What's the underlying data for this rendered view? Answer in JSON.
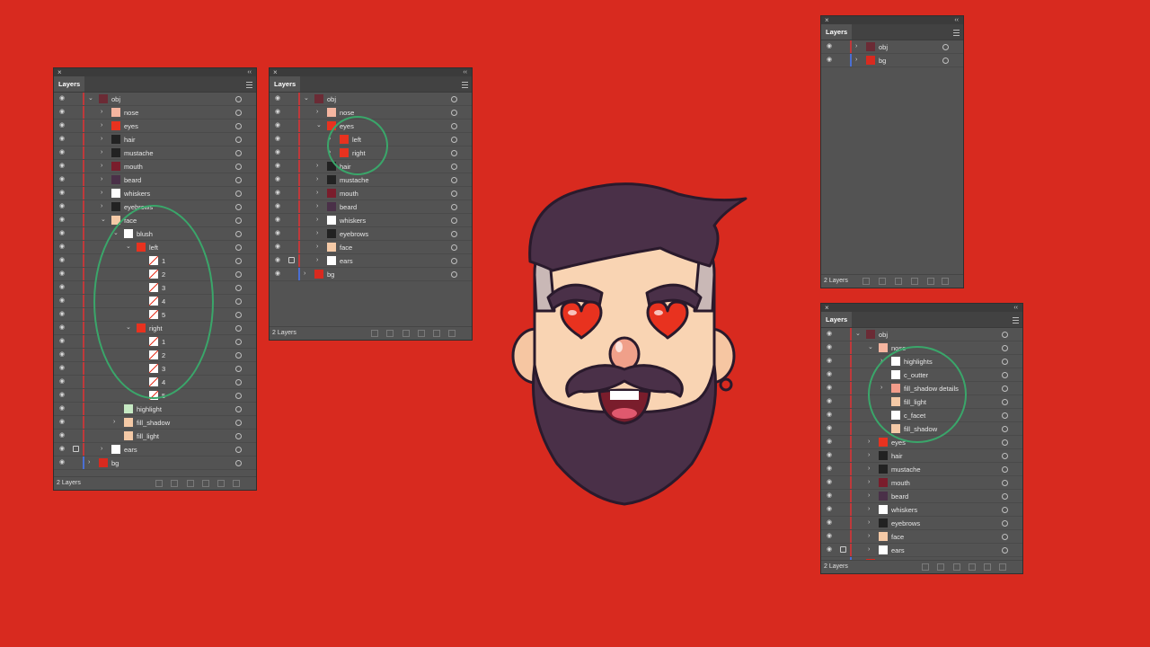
{
  "colors": {
    "background": "#d82a1f",
    "panel": "#535353",
    "circle": "#3aa66a",
    "obj_bar": "#c0393b",
    "bg_bar": "#4a6fd4"
  },
  "common": {
    "tab": "Layers",
    "footer": "2 Layers"
  },
  "panel1": {
    "rows": [
      {
        "label": "obj",
        "level": 0,
        "arrow": "down",
        "bar": "red"
      },
      {
        "label": "nose",
        "level": 1,
        "arrow": "right",
        "bar": "red"
      },
      {
        "label": "eyes",
        "level": 1,
        "arrow": "right",
        "bar": "red"
      },
      {
        "label": "hair",
        "level": 1,
        "arrow": "right",
        "bar": "red"
      },
      {
        "label": "mustache",
        "level": 1,
        "arrow": "right",
        "bar": "red"
      },
      {
        "label": "mouth",
        "level": 1,
        "arrow": "right",
        "bar": "red"
      },
      {
        "label": "beard",
        "level": 1,
        "arrow": "right",
        "bar": "red"
      },
      {
        "label": "whiskers",
        "level": 1,
        "arrow": "right",
        "bar": "red"
      },
      {
        "label": "eyebrows",
        "level": 1,
        "arrow": "right",
        "bar": "red"
      },
      {
        "label": "face",
        "level": 1,
        "arrow": "down",
        "bar": "red"
      },
      {
        "label": "blush",
        "level": 2,
        "arrow": "down",
        "bar": "red"
      },
      {
        "label": "left",
        "level": 3,
        "arrow": "down",
        "bar": "red"
      },
      {
        "label": "1",
        "level": 4,
        "arrow": "",
        "bar": "red"
      },
      {
        "label": "2",
        "level": 4,
        "arrow": "",
        "bar": "red"
      },
      {
        "label": "3",
        "level": 4,
        "arrow": "",
        "bar": "red"
      },
      {
        "label": "4",
        "level": 4,
        "arrow": "",
        "bar": "red"
      },
      {
        "label": "5",
        "level": 4,
        "arrow": "",
        "bar": "red"
      },
      {
        "label": "right",
        "level": 3,
        "arrow": "down",
        "bar": "red"
      },
      {
        "label": "1",
        "level": 4,
        "arrow": "",
        "bar": "red"
      },
      {
        "label": "2",
        "level": 4,
        "arrow": "",
        "bar": "red"
      },
      {
        "label": "3",
        "level": 4,
        "arrow": "",
        "bar": "red"
      },
      {
        "label": "4",
        "level": 4,
        "arrow": "",
        "bar": "red"
      },
      {
        "label": "5",
        "level": 4,
        "arrow": "",
        "bar": "red"
      },
      {
        "label": "highlight",
        "level": 2,
        "arrow": "",
        "bar": "red"
      },
      {
        "label": "fill_shadow",
        "level": 2,
        "arrow": "right",
        "bar": "red"
      },
      {
        "label": "fill_light",
        "level": 2,
        "arrow": "",
        "bar": "red"
      },
      {
        "label": "ears",
        "level": 1,
        "arrow": "right",
        "bar": "red",
        "lock": true
      },
      {
        "label": "bg",
        "level": 0,
        "arrow": "right",
        "bar": "blue"
      }
    ]
  },
  "panel2": {
    "rows": [
      {
        "label": "obj",
        "level": 0,
        "arrow": "down",
        "bar": "red"
      },
      {
        "label": "nose",
        "level": 1,
        "arrow": "right",
        "bar": "red"
      },
      {
        "label": "eyes",
        "level": 1,
        "arrow": "down",
        "bar": "red"
      },
      {
        "label": "left",
        "level": 2,
        "arrow": "right",
        "bar": "red"
      },
      {
        "label": "right",
        "level": 2,
        "arrow": "right",
        "bar": "red"
      },
      {
        "label": "hair",
        "level": 1,
        "arrow": "right",
        "bar": "red"
      },
      {
        "label": "mustache",
        "level": 1,
        "arrow": "right",
        "bar": "red"
      },
      {
        "label": "mouth",
        "level": 1,
        "arrow": "right",
        "bar": "red"
      },
      {
        "label": "beard",
        "level": 1,
        "arrow": "right",
        "bar": "red"
      },
      {
        "label": "whiskers",
        "level": 1,
        "arrow": "right",
        "bar": "red"
      },
      {
        "label": "eyebrows",
        "level": 1,
        "arrow": "right",
        "bar": "red"
      },
      {
        "label": "face",
        "level": 1,
        "arrow": "right",
        "bar": "red"
      },
      {
        "label": "ears",
        "level": 1,
        "arrow": "right",
        "bar": "red",
        "lock": true
      },
      {
        "label": "bg",
        "level": 0,
        "arrow": "right",
        "bar": "blue"
      }
    ]
  },
  "panel3": {
    "rows": [
      {
        "label": "obj",
        "level": 0,
        "arrow": "right",
        "bar": "red"
      },
      {
        "label": "bg",
        "level": 0,
        "arrow": "right",
        "bar": "blue"
      }
    ]
  },
  "panel4": {
    "rows": [
      {
        "label": "obj",
        "level": 0,
        "arrow": "down",
        "bar": "red"
      },
      {
        "label": "nose",
        "level": 1,
        "arrow": "down",
        "bar": "red"
      },
      {
        "label": "highlights",
        "level": 2,
        "arrow": "right",
        "bar": "red"
      },
      {
        "label": "c_outter",
        "level": 2,
        "arrow": "",
        "bar": "red"
      },
      {
        "label": "fill_shadow details",
        "level": 2,
        "arrow": "right",
        "bar": "red"
      },
      {
        "label": "fill_light",
        "level": 2,
        "arrow": "",
        "bar": "red"
      },
      {
        "label": "c_facet",
        "level": 2,
        "arrow": "",
        "bar": "red"
      },
      {
        "label": "fill_shadow",
        "level": 2,
        "arrow": "",
        "bar": "red"
      },
      {
        "label": "eyes",
        "level": 1,
        "arrow": "right",
        "bar": "red"
      },
      {
        "label": "hair",
        "level": 1,
        "arrow": "right",
        "bar": "red"
      },
      {
        "label": "mustache",
        "level": 1,
        "arrow": "right",
        "bar": "red"
      },
      {
        "label": "mouth",
        "level": 1,
        "arrow": "right",
        "bar": "red"
      },
      {
        "label": "beard",
        "level": 1,
        "arrow": "right",
        "bar": "red"
      },
      {
        "label": "whiskers",
        "level": 1,
        "arrow": "right",
        "bar": "red"
      },
      {
        "label": "eyebrows",
        "level": 1,
        "arrow": "right",
        "bar": "red"
      },
      {
        "label": "face",
        "level": 1,
        "arrow": "right",
        "bar": "red"
      },
      {
        "label": "ears",
        "level": 1,
        "arrow": "right",
        "bar": "red",
        "lock": true
      },
      {
        "label": "bg",
        "level": 0,
        "arrow": "right",
        "bar": "blue"
      }
    ]
  }
}
